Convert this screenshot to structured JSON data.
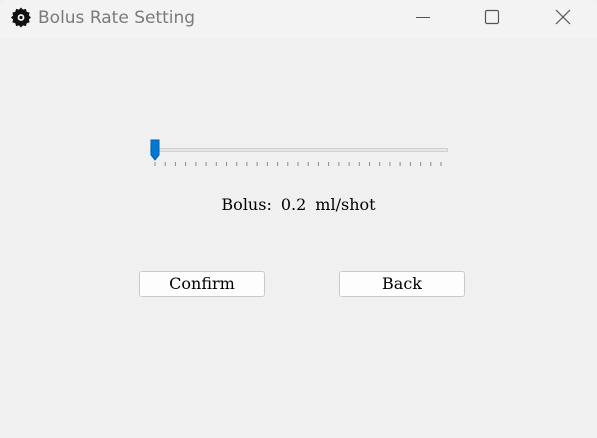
{
  "window": {
    "title": "Bolus Rate Setting",
    "icon": "gear-icon"
  },
  "titlebar_controls": {
    "minimize_icon": "minimize-icon",
    "maximize_icon": "maximize-icon",
    "close_icon": "close-icon"
  },
  "slider": {
    "position_fraction": 0.0,
    "tick_count": 29,
    "accent_color": "#0078d4"
  },
  "bolus": {
    "prefix": "Bolus:",
    "value": "0.2",
    "unit": "ml/shot"
  },
  "buttons": {
    "confirm_label": "Confirm",
    "back_label": "Back"
  }
}
